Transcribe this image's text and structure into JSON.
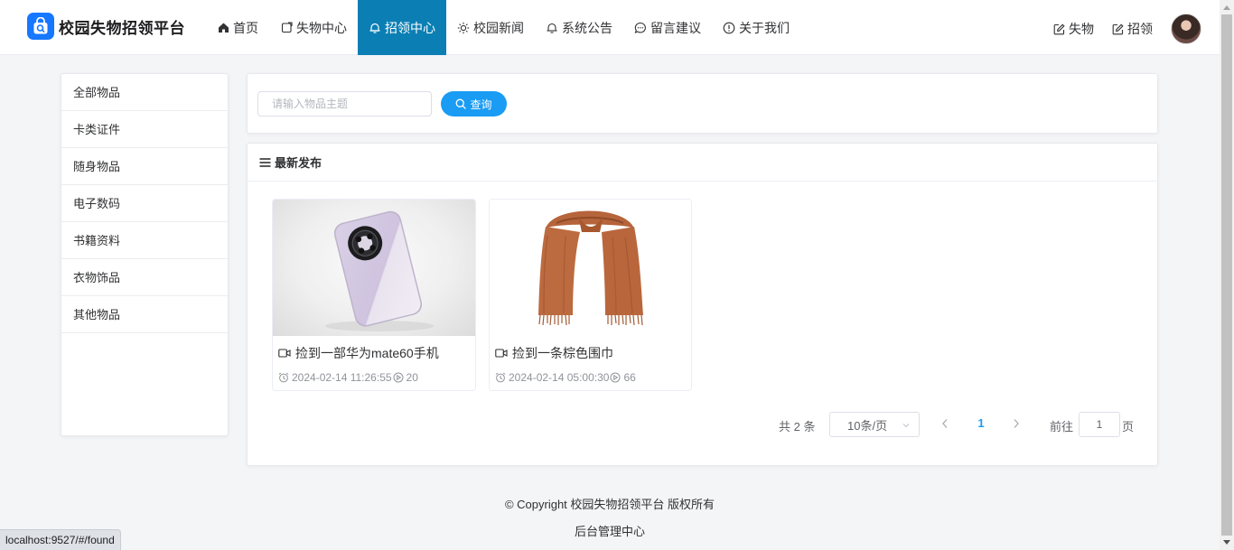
{
  "header": {
    "brand": "校园失物招领平台",
    "nav": [
      {
        "label": "首页",
        "icon": "home-icon"
      },
      {
        "label": "失物中心",
        "icon": "external-square-icon"
      },
      {
        "label": "招领中心",
        "icon": "bell-icon",
        "active": true
      },
      {
        "label": "校园新闻",
        "icon": "sun-icon"
      },
      {
        "label": "系统公告",
        "icon": "bell-icon"
      },
      {
        "label": "留言建议",
        "icon": "chat-icon"
      },
      {
        "label": "关于我们",
        "icon": "info-icon"
      }
    ],
    "right_links": [
      {
        "label": "失物",
        "icon": "edit-icon"
      },
      {
        "label": "招领",
        "icon": "edit-icon"
      }
    ]
  },
  "sidebar": {
    "categories": [
      "全部物品",
      "卡类证件",
      "随身物品",
      "电子数码",
      "书籍资料",
      "衣物饰品",
      "其他物品"
    ]
  },
  "search": {
    "placeholder": "请输入物品主题",
    "button_label": "查询"
  },
  "list": {
    "title": "最新发布",
    "items": [
      {
        "title": "捡到一部华为mate60手机",
        "time": "2024-02-14 11:26:55",
        "views": "20",
        "image": "phone"
      },
      {
        "title": "捡到一条棕色围巾",
        "time": "2024-02-14 05:00:30",
        "views": "66",
        "image": "scarf"
      }
    ]
  },
  "pagination": {
    "total": "共 2 条",
    "page_size": "10条/页",
    "current_page": "1",
    "goto_label": "前往",
    "goto_value": "1",
    "page_unit": "页"
  },
  "footer": {
    "copyright": "© Copyright 校园失物招领平台 版权所有",
    "admin_link": "后台管理中心"
  },
  "status_bar": {
    "url": "localhost:9527/#/found"
  },
  "colors": {
    "nav_active": "#0b7fb4",
    "primary": "#1a9cf4",
    "brand_badge": "#1677ff"
  }
}
